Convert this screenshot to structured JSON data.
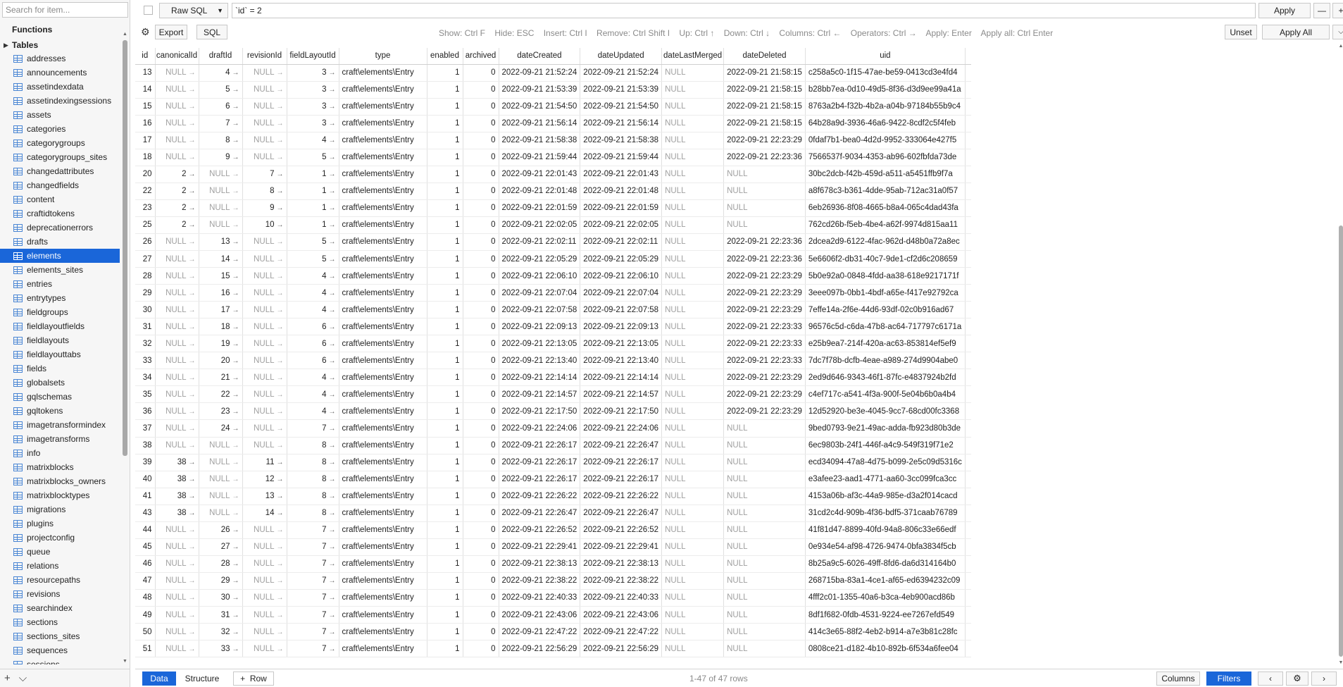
{
  "sidebar": {
    "search_placeholder": "Search for item...",
    "functions_label": "Functions",
    "tables_label": "Tables",
    "tables": [
      "addresses",
      "announcements",
      "assetindexdata",
      "assetindexingsessions",
      "assets",
      "categories",
      "categorygroups",
      "categorygroups_sites",
      "changedattributes",
      "changedfields",
      "content",
      "craftidtokens",
      "deprecationerrors",
      "drafts",
      "elements",
      "elements_sites",
      "entries",
      "entrytypes",
      "fieldgroups",
      "fieldlayoutfields",
      "fieldlayouts",
      "fieldlayouttabs",
      "fields",
      "globalsets",
      "gqlschemas",
      "gqltokens",
      "imagetransformindex",
      "imagetransforms",
      "info",
      "matrixblocks",
      "matrixblocks_owners",
      "matrixblocktypes",
      "migrations",
      "plugins",
      "projectconfig",
      "queue",
      "relations",
      "resourcepaths",
      "revisions",
      "searchindex",
      "sections",
      "sections_sites",
      "sequences",
      "sessions"
    ],
    "selected_table": "elements",
    "footer_add": "+",
    "footer_menu": "⌵"
  },
  "filter": {
    "mode": "Raw SQL",
    "value": "`id` = 2",
    "apply_label": "Apply",
    "minus_label": "—",
    "plus_label": "+"
  },
  "toolbar": {
    "export_label": "Export",
    "sql_label": "SQL",
    "hints": "Show: Ctrl F    Hide: ESC    Insert: Ctrl I    Remove: Ctrl Shift I    Up: Ctrl ↑    Down: Ctrl ↓    Columns: Ctrl ←    Operators: Ctrl →    Apply: Enter    Apply all: Ctrl Enter",
    "unset_label": "Unset",
    "apply_all_label": "Apply All",
    "apply_all_menu": "⌵"
  },
  "grid": {
    "columns": [
      "id",
      "canonicalId",
      "draftId",
      "revisionId",
      "fieldLayoutId",
      "type",
      "enabled",
      "archived",
      "dateCreated",
      "dateUpdated",
      "dateLastMerged",
      "dateDeleted",
      "uid"
    ],
    "rows": [
      [
        "13",
        "NULL",
        "4",
        "NULL",
        "3",
        "craft\\elements\\Entry",
        "1",
        "0",
        "2022-09-21 21:52:24",
        "2022-09-21 21:52:24",
        "NULL",
        "2022-09-21 21:58:15",
        "c258a5c0-1f15-47ae-be59-0413cd3e4fd4"
      ],
      [
        "14",
        "NULL",
        "5",
        "NULL",
        "3",
        "craft\\elements\\Entry",
        "1",
        "0",
        "2022-09-21 21:53:39",
        "2022-09-21 21:53:39",
        "NULL",
        "2022-09-21 21:58:15",
        "b28bb7ea-0d10-49d5-8f36-d3d9ee99a41a"
      ],
      [
        "15",
        "NULL",
        "6",
        "NULL",
        "3",
        "craft\\elements\\Entry",
        "1",
        "0",
        "2022-09-21 21:54:50",
        "2022-09-21 21:54:50",
        "NULL",
        "2022-09-21 21:58:15",
        "8763a2b4-f32b-4b2a-a04b-97184b55b9c4"
      ],
      [
        "16",
        "NULL",
        "7",
        "NULL",
        "3",
        "craft\\elements\\Entry",
        "1",
        "0",
        "2022-09-21 21:56:14",
        "2022-09-21 21:56:14",
        "NULL",
        "2022-09-21 21:58:15",
        "64b28a9d-3936-46a6-9422-8cdf2c5f4feb"
      ],
      [
        "17",
        "NULL",
        "8",
        "NULL",
        "4",
        "craft\\elements\\Entry",
        "1",
        "0",
        "2022-09-21 21:58:38",
        "2022-09-21 21:58:38",
        "NULL",
        "2022-09-21 22:23:29",
        "0fdaf7b1-bea0-4d2d-9952-333064e427f5"
      ],
      [
        "18",
        "NULL",
        "9",
        "NULL",
        "5",
        "craft\\elements\\Entry",
        "1",
        "0",
        "2022-09-21 21:59:44",
        "2022-09-21 21:59:44",
        "NULL",
        "2022-09-21 22:23:36",
        "7566537f-9034-4353-ab96-602fbfda73de"
      ],
      [
        "20",
        "2",
        "NULL",
        "7",
        "1",
        "craft\\elements\\Entry",
        "1",
        "0",
        "2022-09-21 22:01:43",
        "2022-09-21 22:01:43",
        "NULL",
        "NULL",
        "30bc2dcb-f42b-459d-a511-a5451ffb9f7a"
      ],
      [
        "22",
        "2",
        "NULL",
        "8",
        "1",
        "craft\\elements\\Entry",
        "1",
        "0",
        "2022-09-21 22:01:48",
        "2022-09-21 22:01:48",
        "NULL",
        "NULL",
        "a8f678c3-b361-4dde-95ab-712ac31a0f57"
      ],
      [
        "23",
        "2",
        "NULL",
        "9",
        "1",
        "craft\\elements\\Entry",
        "1",
        "0",
        "2022-09-21 22:01:59",
        "2022-09-21 22:01:59",
        "NULL",
        "NULL",
        "6eb26936-8f08-4665-b8a4-065c4dad43fa"
      ],
      [
        "25",
        "2",
        "NULL",
        "10",
        "1",
        "craft\\elements\\Entry",
        "1",
        "0",
        "2022-09-21 22:02:05",
        "2022-09-21 22:02:05",
        "NULL",
        "NULL",
        "762cd26b-f5eb-4be4-a62f-9974d815aa11"
      ],
      [
        "26",
        "NULL",
        "13",
        "NULL",
        "5",
        "craft\\elements\\Entry",
        "1",
        "0",
        "2022-09-21 22:02:11",
        "2022-09-21 22:02:11",
        "NULL",
        "2022-09-21 22:23:36",
        "2dcea2d9-6122-4fac-962d-d48b0a72a8ec"
      ],
      [
        "27",
        "NULL",
        "14",
        "NULL",
        "5",
        "craft\\elements\\Entry",
        "1",
        "0",
        "2022-09-21 22:05:29",
        "2022-09-21 22:05:29",
        "NULL",
        "2022-09-21 22:23:36",
        "5e6606f2-db31-40c7-9de1-cf2d6c208659"
      ],
      [
        "28",
        "NULL",
        "15",
        "NULL",
        "4",
        "craft\\elements\\Entry",
        "1",
        "0",
        "2022-09-21 22:06:10",
        "2022-09-21 22:06:10",
        "NULL",
        "2022-09-21 22:23:29",
        "5b0e92a0-0848-4fdd-aa38-618e9217171f"
      ],
      [
        "29",
        "NULL",
        "16",
        "NULL",
        "4",
        "craft\\elements\\Entry",
        "1",
        "0",
        "2022-09-21 22:07:04",
        "2022-09-21 22:07:04",
        "NULL",
        "2022-09-21 22:23:29",
        "3eee097b-0bb1-4bdf-a65e-f417e92792ca"
      ],
      [
        "30",
        "NULL",
        "17",
        "NULL",
        "4",
        "craft\\elements\\Entry",
        "1",
        "0",
        "2022-09-21 22:07:58",
        "2022-09-21 22:07:58",
        "NULL",
        "2022-09-21 22:23:29",
        "7effe14a-2f6e-44d6-93df-02c0b916ad67"
      ],
      [
        "31",
        "NULL",
        "18",
        "NULL",
        "6",
        "craft\\elements\\Entry",
        "1",
        "0",
        "2022-09-21 22:09:13",
        "2022-09-21 22:09:13",
        "NULL",
        "2022-09-21 22:23:33",
        "96576c5d-c6da-47b8-ac64-717797c6171a"
      ],
      [
        "32",
        "NULL",
        "19",
        "NULL",
        "6",
        "craft\\elements\\Entry",
        "1",
        "0",
        "2022-09-21 22:13:05",
        "2022-09-21 22:13:05",
        "NULL",
        "2022-09-21 22:23:33",
        "e25b9ea7-214f-420a-ac63-853814ef5ef9"
      ],
      [
        "33",
        "NULL",
        "20",
        "NULL",
        "6",
        "craft\\elements\\Entry",
        "1",
        "0",
        "2022-09-21 22:13:40",
        "2022-09-21 22:13:40",
        "NULL",
        "2022-09-21 22:23:33",
        "7dc7f78b-dcfb-4eae-a989-274d9904abe0"
      ],
      [
        "34",
        "NULL",
        "21",
        "NULL",
        "4",
        "craft\\elements\\Entry",
        "1",
        "0",
        "2022-09-21 22:14:14",
        "2022-09-21 22:14:14",
        "NULL",
        "2022-09-21 22:23:29",
        "2ed9d646-9343-46f1-87fc-e4837924b2fd"
      ],
      [
        "35",
        "NULL",
        "22",
        "NULL",
        "4",
        "craft\\elements\\Entry",
        "1",
        "0",
        "2022-09-21 22:14:57",
        "2022-09-21 22:14:57",
        "NULL",
        "2022-09-21 22:23:29",
        "c4ef717c-a541-4f3a-900f-5e04b6b0a4b4"
      ],
      [
        "36",
        "NULL",
        "23",
        "NULL",
        "4",
        "craft\\elements\\Entry",
        "1",
        "0",
        "2022-09-21 22:17:50",
        "2022-09-21 22:17:50",
        "NULL",
        "2022-09-21 22:23:29",
        "12d52920-be3e-4045-9cc7-68cd00fc3368"
      ],
      [
        "37",
        "NULL",
        "24",
        "NULL",
        "7",
        "craft\\elements\\Entry",
        "1",
        "0",
        "2022-09-21 22:24:06",
        "2022-09-21 22:24:06",
        "NULL",
        "NULL",
        "9bed0793-9e21-49ac-adda-fb923d80b3de"
      ],
      [
        "38",
        "NULL",
        "NULL",
        "NULL",
        "8",
        "craft\\elements\\Entry",
        "1",
        "0",
        "2022-09-21 22:26:17",
        "2022-09-21 22:26:47",
        "NULL",
        "NULL",
        "6ec9803b-24f1-446f-a4c9-549f319f71e2"
      ],
      [
        "39",
        "38",
        "NULL",
        "11",
        "8",
        "craft\\elements\\Entry",
        "1",
        "0",
        "2022-09-21 22:26:17",
        "2022-09-21 22:26:17",
        "NULL",
        "NULL",
        "ecd34094-47a8-4d75-b099-2e5c09d5316c"
      ],
      [
        "40",
        "38",
        "NULL",
        "12",
        "8",
        "craft\\elements\\Entry",
        "1",
        "0",
        "2022-09-21 22:26:17",
        "2022-09-21 22:26:17",
        "NULL",
        "NULL",
        "e3afee23-aad1-4771-aa60-3cc099fca3cc"
      ],
      [
        "41",
        "38",
        "NULL",
        "13",
        "8",
        "craft\\elements\\Entry",
        "1",
        "0",
        "2022-09-21 22:26:22",
        "2022-09-21 22:26:22",
        "NULL",
        "NULL",
        "4153a06b-af3c-44a9-985e-d3a2f014cacd"
      ],
      [
        "43",
        "38",
        "NULL",
        "14",
        "8",
        "craft\\elements\\Entry",
        "1",
        "0",
        "2022-09-21 22:26:47",
        "2022-09-21 22:26:47",
        "NULL",
        "NULL",
        "31cd2c4d-909b-4f36-bdf5-371caab76789"
      ],
      [
        "44",
        "NULL",
        "26",
        "NULL",
        "7",
        "craft\\elements\\Entry",
        "1",
        "0",
        "2022-09-21 22:26:52",
        "2022-09-21 22:26:52",
        "NULL",
        "NULL",
        "41f81d47-8899-40fd-94a8-806c33e66edf"
      ],
      [
        "45",
        "NULL",
        "27",
        "NULL",
        "7",
        "craft\\elements\\Entry",
        "1",
        "0",
        "2022-09-21 22:29:41",
        "2022-09-21 22:29:41",
        "NULL",
        "NULL",
        "0e934e54-af98-4726-9474-0bfa3834f5cb"
      ],
      [
        "46",
        "NULL",
        "28",
        "NULL",
        "7",
        "craft\\elements\\Entry",
        "1",
        "0",
        "2022-09-21 22:38:13",
        "2022-09-21 22:38:13",
        "NULL",
        "NULL",
        "8b25a9c5-6026-49ff-8fd6-da6d314164b0"
      ],
      [
        "47",
        "NULL",
        "29",
        "NULL",
        "7",
        "craft\\elements\\Entry",
        "1",
        "0",
        "2022-09-21 22:38:22",
        "2022-09-21 22:38:22",
        "NULL",
        "NULL",
        "268715ba-83a1-4ce1-af65-ed6394232c09"
      ],
      [
        "48",
        "NULL",
        "30",
        "NULL",
        "7",
        "craft\\elements\\Entry",
        "1",
        "0",
        "2022-09-21 22:40:33",
        "2022-09-21 22:40:33",
        "NULL",
        "NULL",
        "4fff2c01-1355-40a6-b3ca-4eb900acd86b"
      ],
      [
        "49",
        "NULL",
        "31",
        "NULL",
        "7",
        "craft\\elements\\Entry",
        "1",
        "0",
        "2022-09-21 22:43:06",
        "2022-09-21 22:43:06",
        "NULL",
        "NULL",
        "8df1f682-0fdb-4531-9224-ee7267efd549"
      ],
      [
        "50",
        "NULL",
        "32",
        "NULL",
        "7",
        "craft\\elements\\Entry",
        "1",
        "0",
        "2022-09-21 22:47:22",
        "2022-09-21 22:47:22",
        "NULL",
        "NULL",
        "414c3e65-88f2-4eb2-b914-a7e3b81c28fc"
      ],
      [
        "51",
        "NULL",
        "33",
        "NULL",
        "7",
        "craft\\elements\\Entry",
        "1",
        "0",
        "2022-09-21 22:56:29",
        "2022-09-21 22:56:29",
        "NULL",
        "NULL",
        "0808ce21-d182-4b10-892b-6f534a6fee04"
      ]
    ],
    "fk_arrow": "→"
  },
  "bottom": {
    "tab_data": "Data",
    "tab_structure": "Structure",
    "add_row_label": "+  Row",
    "row_count": "1-47 of 47 rows",
    "columns_label": "Columns",
    "filters_label": "Filters",
    "prev_label": "‹",
    "next_label": "›"
  },
  "colors": {
    "accent": "#1a66d9",
    "null_text": "#a0a0a0",
    "hint_text": "#8a8a8a"
  }
}
